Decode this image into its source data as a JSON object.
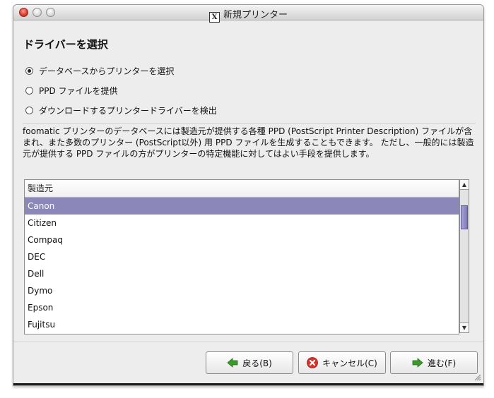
{
  "window": {
    "title": "新規プリンター"
  },
  "heading": "ドライバーを選択",
  "radios": [
    {
      "label": "データベースからプリンターを選択",
      "checked": true
    },
    {
      "label": "PPD ファイルを提供",
      "checked": false
    },
    {
      "label": "ダウンロードするプリンタードライバーを検出",
      "checked": false
    }
  ],
  "description": "foomatic プリンターのデータベースには製造元が提供する各種 PPD (PostScript Printer Description) ファイルが含まれ、また多数のプリンター (PostScript以外) 用 PPD ファイルを生成することもできます。 ただし、一般的には製造元が提供する PPD ファイルの方がプリンターの特定機能に対してはよい手段を提供します。",
  "list": {
    "header": "製造元",
    "items": [
      "Canon",
      "Citizen",
      "Compaq",
      "DEC",
      "Dell",
      "Dymo",
      "Epson",
      "Fujitsu"
    ],
    "selected_index": 0
  },
  "buttons": {
    "back": "戻る(B)",
    "cancel": "キャンセル(C)",
    "forward": "進む(F)"
  },
  "colors": {
    "selection": "#8b87b8",
    "back_icon": "#3a9a2a",
    "cancel_icon": "#d8322a"
  }
}
